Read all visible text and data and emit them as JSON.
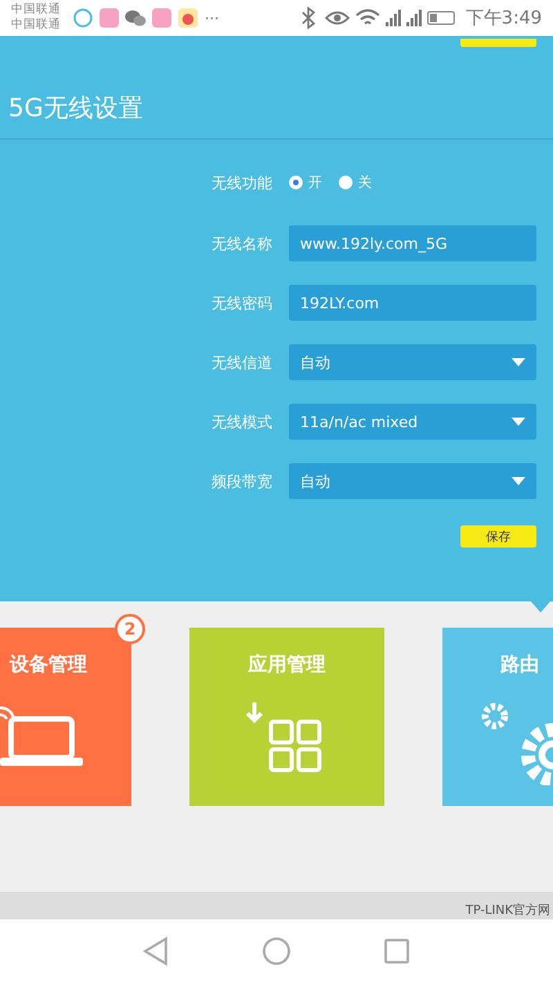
{
  "status_bar": {
    "carriers": [
      "中国联通",
      "中国联通"
    ],
    "more": "···",
    "time": "下午3:49"
  },
  "panel": {
    "title": "5G无线设置",
    "fields": [
      {
        "kind": "radio",
        "label": "无线功能",
        "options": [
          {
            "label": "开",
            "selected": true
          },
          {
            "label": "关",
            "selected": false
          }
        ]
      },
      {
        "kind": "text",
        "label": "无线名称",
        "value": "www.192ly.com_5G"
      },
      {
        "kind": "text",
        "label": "无线密码",
        "value": "192LY.com"
      },
      {
        "kind": "select",
        "label": "无线信道",
        "value": "自动"
      },
      {
        "kind": "select",
        "label": "无线模式",
        "value": "11a/n/ac mixed"
      },
      {
        "kind": "select",
        "label": "频段带宽",
        "value": "自动"
      }
    ],
    "save": "保存"
  },
  "tiles": [
    {
      "kind": "devices",
      "title": "设备管理",
      "badge": "2",
      "color": "#ff7043"
    },
    {
      "kind": "apps",
      "title": "应用管理",
      "color": "#b8d236"
    },
    {
      "kind": "router",
      "title": "路由",
      "color": "#5bc4e6"
    }
  ],
  "footer": "TP-LINK官方网"
}
